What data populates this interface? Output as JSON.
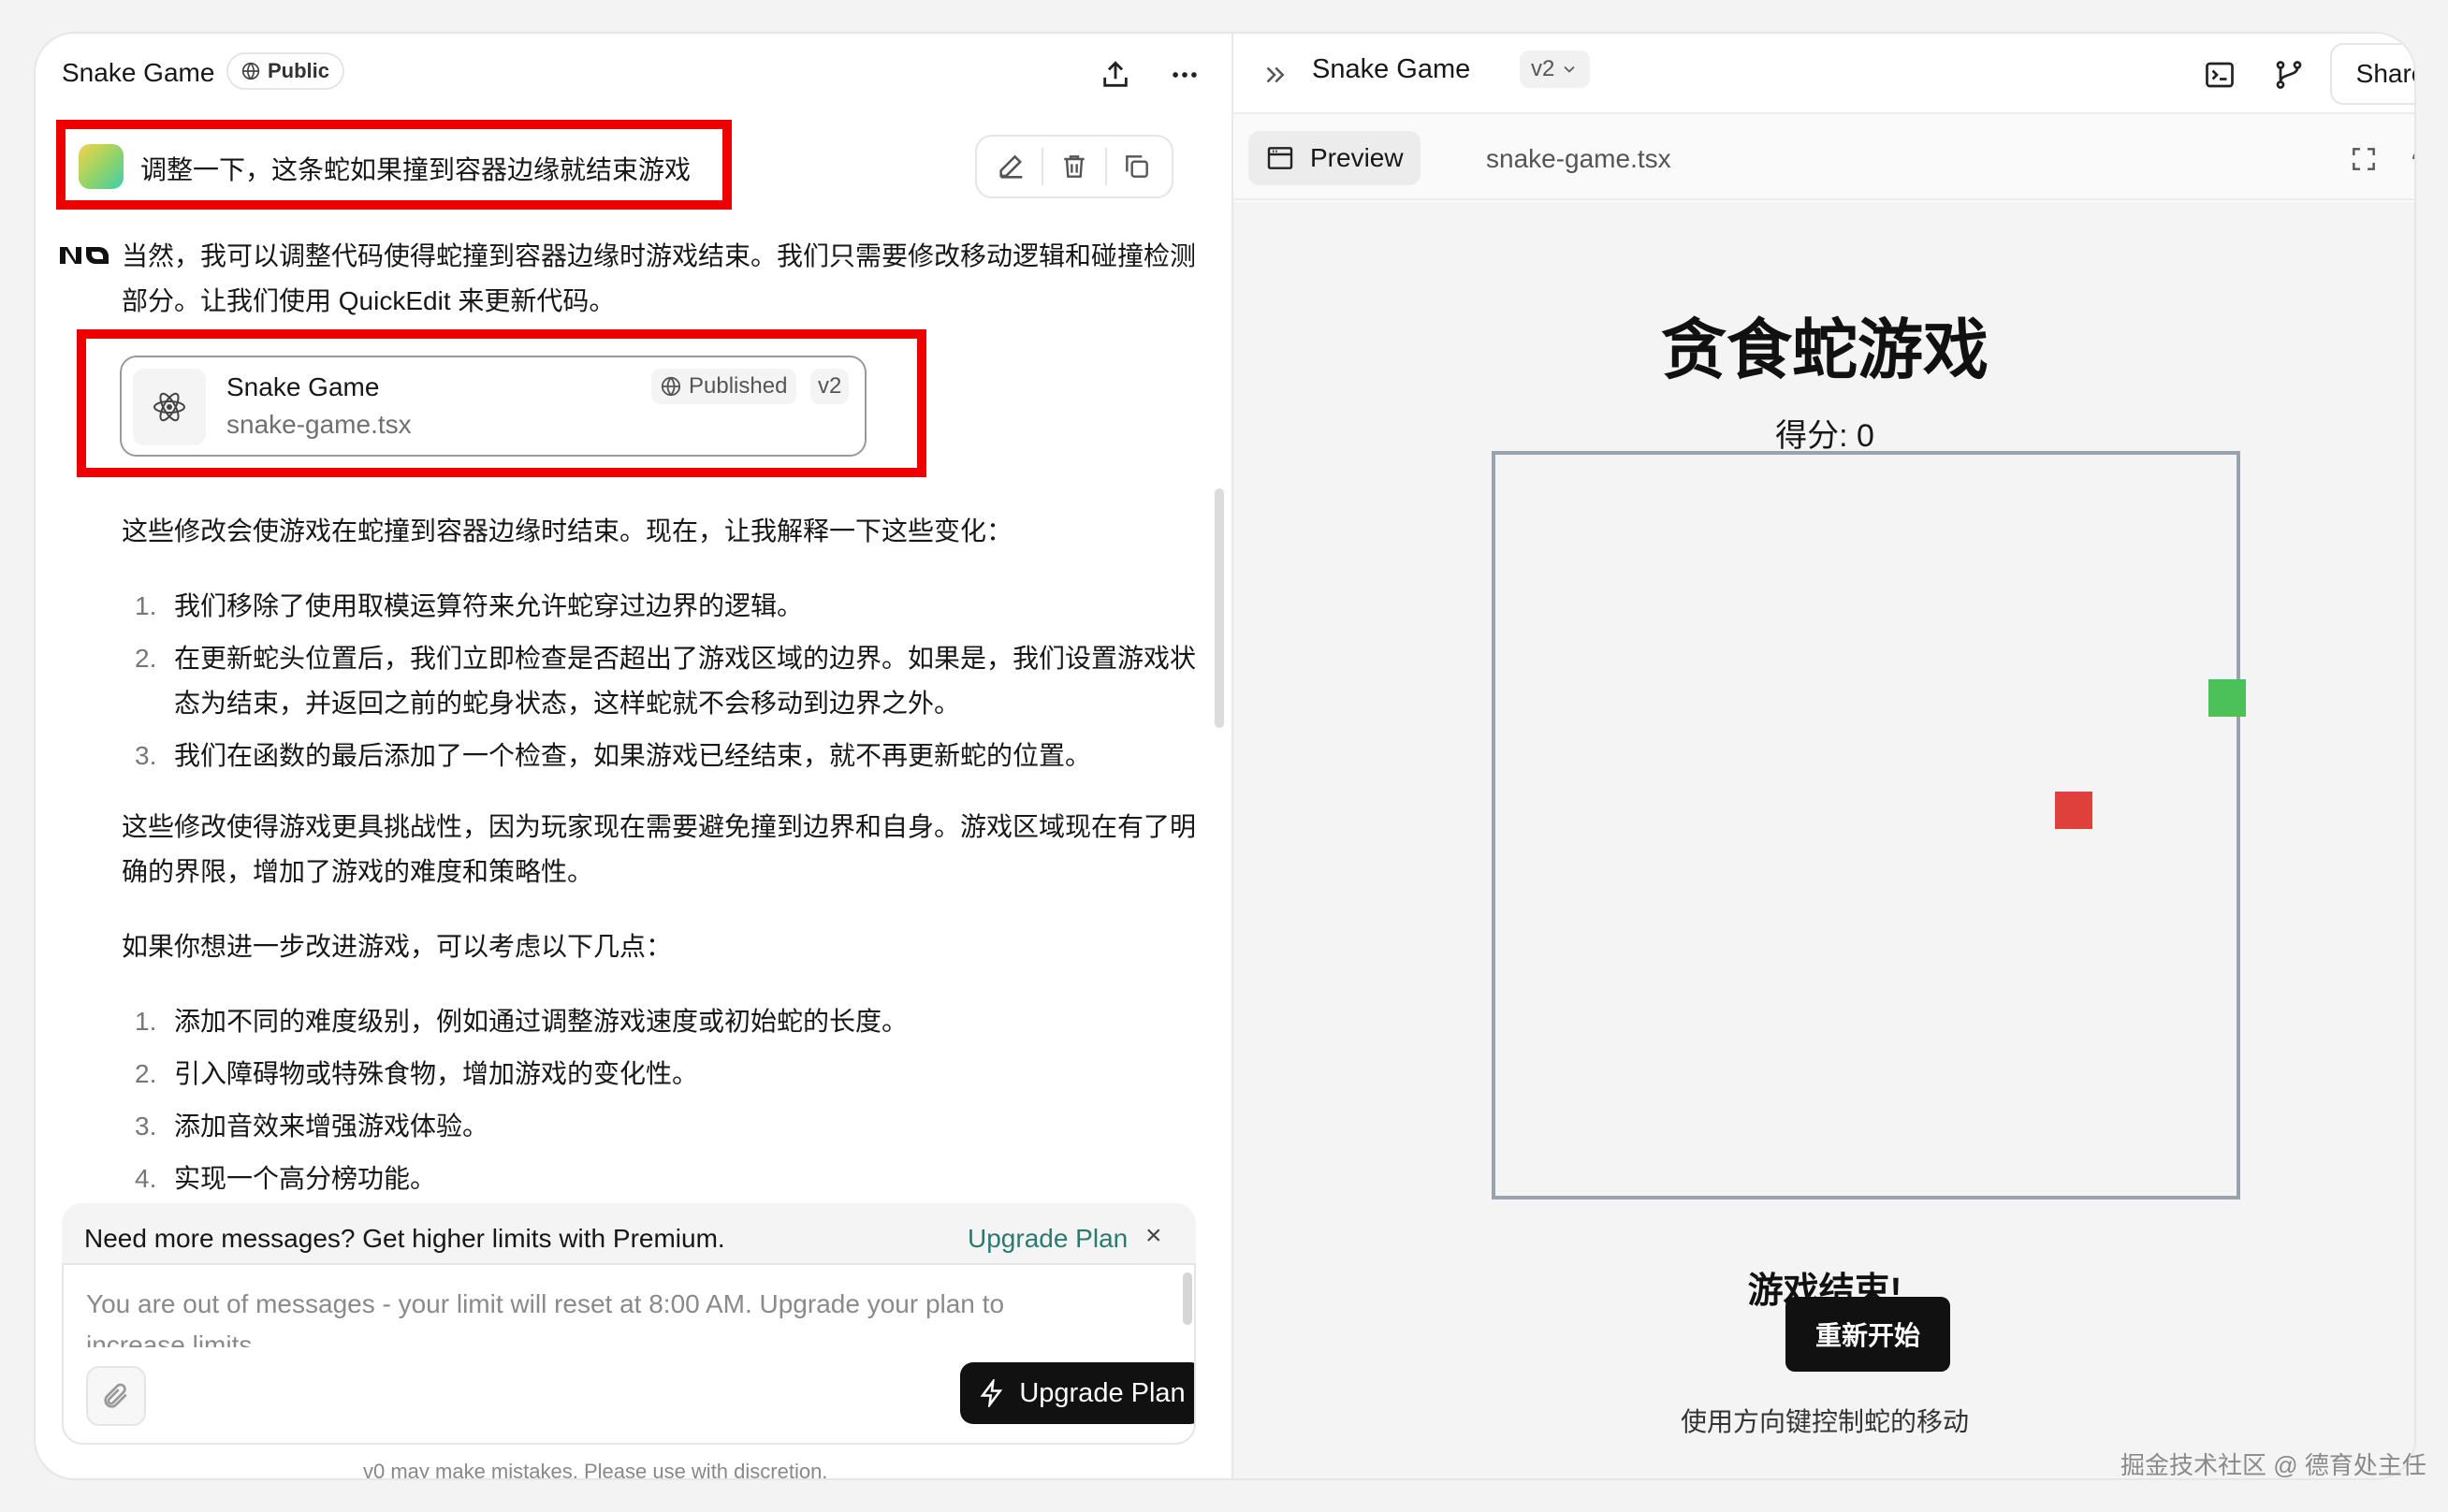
{
  "chat": {
    "project_title": "Snake Game",
    "visibility_label": "Public",
    "user_message": "调整一下，这条蛇如果撞到容器边缘就结束游戏",
    "assistant_intro": "当然，我可以调整代码使得蛇撞到容器边缘时游戏结束。我们只需要修改移动逻辑和碰撞检测部分。让我们使用 QuickEdit 来更新代码。",
    "version_card": {
      "title": "Snake Game",
      "file": "snake-game.tsx",
      "status": "Published",
      "version": "v2"
    },
    "explain_intro": "这些修改会使游戏在蛇撞到容器边缘时结束。现在，让我解释一下这些变化：",
    "changes": [
      {
        "num": "1.",
        "text": "我们移除了使用取模运算符来允许蛇穿过边界的逻辑。"
      },
      {
        "num": "2.",
        "text": "在更新蛇头位置后，我们立即检查是否超出了游戏区域的边界。如果是，我们设置游戏状态为结束，并返回之前的蛇身状态，这样蛇就不会移动到边界之外。"
      },
      {
        "num": "3.",
        "text": "我们在函数的最后添加了一个检查，如果游戏已经结束，就不再更新蛇的位置。"
      }
    ],
    "summary": "这些修改使得游戏更具挑战性，因为玩家现在需要避免撞到边界和自身。游戏区域现在有了明确的界限，增加了游戏的难度和策略性。",
    "suggest_intro": "如果你想进一步改进游戏，可以考虑以下几点：",
    "suggestions": [
      {
        "num": "1.",
        "text": "添加不同的难度级别，例如通过调整游戏速度或初始蛇的长度。"
      },
      {
        "num": "2.",
        "text": "引入障碍物或特殊食物，增加游戏的变化性。"
      },
      {
        "num": "3.",
        "text": "添加音效来增强游戏体验。"
      },
      {
        "num": "4.",
        "text": "实现一个高分榜功能。"
      }
    ],
    "promo_text": "Need more messages? Get higher limits with Premium.",
    "promo_link": "Upgrade Plan",
    "promo_close": "×",
    "composer_text": "You are out of messages - your limit will reset at 8:00 AM. Upgrade your plan to increase limits.",
    "upgrade_button": "Upgrade Plan",
    "disclaimer": "v0 may make mistakes. Please use with discretion."
  },
  "preview": {
    "title": "Snake Game",
    "version": "v2",
    "share_label": "Share",
    "tab_preview": "Preview",
    "tab_file": "snake-game.tsx",
    "game": {
      "heading": "贪食蛇游戏",
      "score_label": "得分: 0",
      "game_over": "游戏结束!",
      "restart_label": "重新开始",
      "hint": "使用方向键控制蛇的移动",
      "grid_size": 20,
      "snake": [
        [
          19,
          6
        ]
      ],
      "food": [
        15,
        9
      ],
      "snake_color": "#4cc15a",
      "food_color": "#e0403b"
    }
  },
  "watermark": "掘金技术社区 @ 德育处主任",
  "colors": {
    "highlight_red": "#ef0000",
    "upgrade_link": "#2b7a6f",
    "button_dark": "#111111"
  },
  "icons": [
    "globe-icon",
    "share-upload-icon",
    "more-icon",
    "edit-icon",
    "trash-icon",
    "copy-icon",
    "v0-logo",
    "react-atom-icon",
    "paperclip-icon",
    "lightning-icon",
    "chevrons-right-icon",
    "chevron-down-icon",
    "terminal-icon",
    "git-fork-icon",
    "browser-icon",
    "expand-icon",
    "refresh-icon"
  ]
}
